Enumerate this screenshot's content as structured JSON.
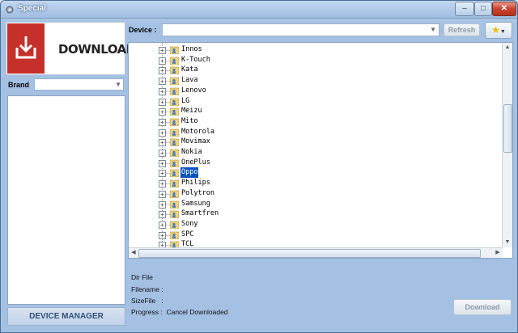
{
  "window": {
    "title": "Special",
    "minimize": "–",
    "maximize": "□",
    "close": "✕"
  },
  "left": {
    "download_label": "DOWNLOAD",
    "brand_label": "Brand",
    "brand_value": "",
    "device_manager": "DEVICE MANAGER"
  },
  "top": {
    "device_label": "Device :",
    "device_value": "",
    "refresh_label": "Refresh",
    "favorites_icon": "star-icon"
  },
  "tree": {
    "items": [
      {
        "label": "Innos",
        "selected": false
      },
      {
        "label": "K-Touch",
        "selected": false
      },
      {
        "label": "Kata",
        "selected": false
      },
      {
        "label": "Lava",
        "selected": false
      },
      {
        "label": "Lenovo",
        "selected": false
      },
      {
        "label": "LG",
        "selected": false
      },
      {
        "label": "Meizu",
        "selected": false
      },
      {
        "label": "Mito",
        "selected": false
      },
      {
        "label": "Motorola",
        "selected": false
      },
      {
        "label": "Movimax",
        "selected": false
      },
      {
        "label": "Nokia",
        "selected": false
      },
      {
        "label": "OnePlus",
        "selected": false
      },
      {
        "label": "Oppo",
        "selected": true
      },
      {
        "label": "Philips",
        "selected": false
      },
      {
        "label": "Polytron",
        "selected": false
      },
      {
        "label": "Samsung",
        "selected": false
      },
      {
        "label": "Smartfren",
        "selected": false
      },
      {
        "label": "Sony",
        "selected": false
      },
      {
        "label": "SPC",
        "selected": false
      },
      {
        "label": "TCL",
        "selected": false
      }
    ]
  },
  "info": {
    "dir_file": "Dir File",
    "filename": "Filename :",
    "sizefile": "SizeFile   :",
    "progress": "Progress :  Cancel Downloaded",
    "download_button": "Download"
  },
  "colors": {
    "accent_red": "#c5312a",
    "selection_blue": "#0a53c1",
    "window_blue": "#a4c1e4"
  }
}
